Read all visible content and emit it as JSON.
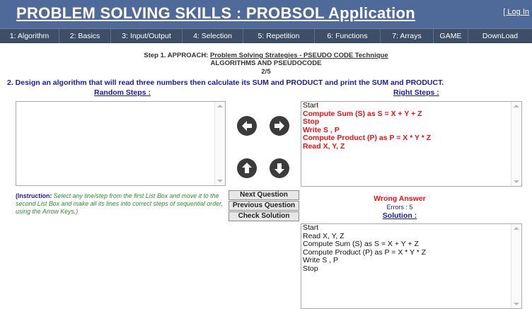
{
  "app": {
    "title": "PROBLEM SOLVING SKILLS : PROBSOL Application",
    "login_link": "[ Log In"
  },
  "nav": {
    "items": [
      {
        "label": "1: Algorithm"
      },
      {
        "label": "2: Basics"
      },
      {
        "label": "3: Input/Output"
      },
      {
        "label": "4: Selection"
      },
      {
        "label": "5: Repetition"
      },
      {
        "label": "6: Functions"
      },
      {
        "label": "7: Arrays"
      },
      {
        "label": "GAME"
      },
      {
        "label": "DownLoad"
      }
    ]
  },
  "step": {
    "prefix": "Step 1.  APPROACH: ",
    "link": "Problem Solving Strategies - PSEUDO CODE Technique",
    "subtitle": "ALGORITHMS AND PSEUDOCODE",
    "progress": "2/5"
  },
  "question": "2. Design an algorithm that will read three numbers then calculate its SUM and PRODUCT and print the SUM and PRODUCT.",
  "random_steps": {
    "label": "Random Steps :",
    "items": []
  },
  "right_steps": {
    "label": "Right Steps :",
    "items": [
      "Start",
      "Compute Sum (S) as  S = X + Y + Z",
      "Stop",
      "Write S , P",
      "Compute Product (P) as P = X * Y * Z",
      "Read X, Y, Z"
    ]
  },
  "arrows": {
    "left": "arrow-left-icon",
    "right": "arrow-right-icon",
    "up": "arrow-up-icon",
    "down": "arrow-down-icon"
  },
  "instruction": {
    "bold": "(Instruction:",
    "text": " Select any line/step from the first List Box and move it to the second List Box and make all its lines into correct steps of sequential order, using the Arrow Keys.)"
  },
  "buttons": {
    "next": "Next Question",
    "previous": "Previous Question",
    "check": "Check Solution"
  },
  "result": {
    "status": "Wrong Answer",
    "errors": "Errors : 5",
    "solution_label": "Solution :"
  },
  "solution": {
    "items": [
      "Start",
      "Read X, Y, Z",
      "Compute Sum (S) as  S = X + Y + Z",
      "Compute Product (P) as P = X * Y * Z",
      "Write S , P",
      "Stop"
    ]
  },
  "colors": {
    "header_bg": "#4f6a98",
    "nav_bg": "#3d4f66",
    "link_blue": "#1a1aa6",
    "error_red": "#ee1111",
    "instruction_green": "#2d8f2d"
  }
}
